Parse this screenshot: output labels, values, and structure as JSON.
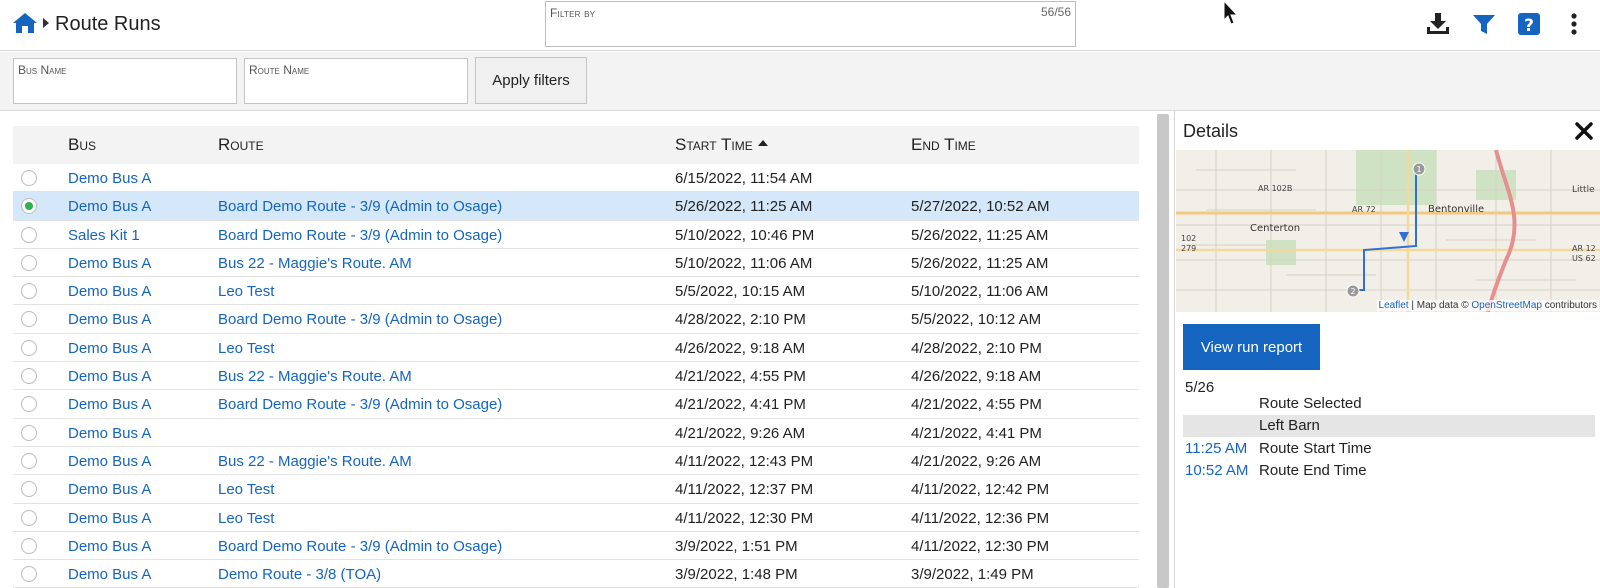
{
  "header": {
    "page_title": "Route Runs",
    "filter_label": "Filter by",
    "filter_count": "56/56"
  },
  "filters": {
    "bus_name_label": "Bus Name",
    "route_name_label": "Route Name",
    "apply_label": "Apply filters"
  },
  "table": {
    "columns": {
      "bus": "Bus",
      "route": "Route",
      "start": "Start Time",
      "end": "End Time"
    },
    "rows": [
      {
        "bus": "Demo Bus A",
        "route": "",
        "start": "6/15/2022, 11:54 AM",
        "end": "",
        "selected": false
      },
      {
        "bus": "Demo Bus A",
        "route": "Board Demo Route - 3/9 (Admin to Osage)",
        "start": "5/26/2022, 11:25 AM",
        "end": "5/27/2022, 10:52 AM",
        "selected": true
      },
      {
        "bus": "Sales Kit 1",
        "route": "Board Demo Route - 3/9 (Admin to Osage)",
        "start": "5/10/2022, 10:46 PM",
        "end": "5/26/2022, 11:25 AM",
        "selected": false
      },
      {
        "bus": "Demo Bus A",
        "route": "Bus 22 - Maggie's Route. AM",
        "start": "5/10/2022, 11:06 AM",
        "end": "5/26/2022, 11:25 AM",
        "selected": false
      },
      {
        "bus": "Demo Bus A",
        "route": "Leo Test",
        "start": "5/5/2022, 10:15 AM",
        "end": "5/10/2022, 11:06 AM",
        "selected": false
      },
      {
        "bus": "Demo Bus A",
        "route": "Board Demo Route - 3/9 (Admin to Osage)",
        "start": "4/28/2022, 2:10 PM",
        "end": "5/5/2022, 10:12 AM",
        "selected": false
      },
      {
        "bus": "Demo Bus A",
        "route": "Leo Test",
        "start": "4/26/2022, 9:18 AM",
        "end": "4/28/2022, 2:10 PM",
        "selected": false
      },
      {
        "bus": "Demo Bus A",
        "route": "Bus 22 - Maggie's Route. AM",
        "start": "4/21/2022, 4:55 PM",
        "end": "4/26/2022, 9:18 AM",
        "selected": false
      },
      {
        "bus": "Demo Bus A",
        "route": "Board Demo Route - 3/9 (Admin to Osage)",
        "start": "4/21/2022, 4:41 PM",
        "end": "4/21/2022, 4:55 PM",
        "selected": false
      },
      {
        "bus": "Demo Bus A",
        "route": "",
        "start": "4/21/2022, 9:26 AM",
        "end": "4/21/2022, 4:41 PM",
        "selected": false
      },
      {
        "bus": "Demo Bus A",
        "route": "Bus 22 - Maggie's Route. AM",
        "start": "4/11/2022, 12:43 PM",
        "end": "4/21/2022, 9:26 AM",
        "selected": false
      },
      {
        "bus": "Demo Bus A",
        "route": "Leo Test",
        "start": "4/11/2022, 12:37 PM",
        "end": "4/11/2022, 12:42 PM",
        "selected": false
      },
      {
        "bus": "Demo Bus A",
        "route": "Leo Test",
        "start": "4/11/2022, 12:30 PM",
        "end": "4/11/2022, 12:36 PM",
        "selected": false
      },
      {
        "bus": "Demo Bus A",
        "route": "Board Demo Route - 3/9 (Admin to Osage)",
        "start": "3/9/2022, 1:51 PM",
        "end": "4/11/2022, 12:30 PM",
        "selected": false
      },
      {
        "bus": "Demo Bus A",
        "route": "Demo Route - 3/8 (TOA)",
        "start": "3/9/2022, 1:48 PM",
        "end": "3/9/2022, 1:49 PM",
        "selected": false
      }
    ]
  },
  "details": {
    "title": "Details",
    "map_labels": [
      "Bentonville",
      "Centerton",
      "AR 102B",
      "AR 72",
      "102",
      "279",
      "AR 12",
      "US 62",
      "Little"
    ],
    "map_markers": [
      "1",
      "2"
    ],
    "attribution": {
      "leaflet": "Leaflet",
      "sep": " | Map data © ",
      "osm": "OpenStreetMap",
      "tail": " contributors"
    },
    "view_report_label": "View run report",
    "date": "5/26",
    "events": [
      {
        "time": "",
        "desc": "Route Selected",
        "highlight": false
      },
      {
        "time": "",
        "desc": "Left Barn",
        "highlight": true
      },
      {
        "time": "11:25 AM",
        "desc": "Route Start Time",
        "highlight": false
      },
      {
        "time": "10:52 AM",
        "desc": "Route End Time",
        "highlight": false
      }
    ]
  },
  "colors": {
    "accent": "#1565c0",
    "selected_row": "#d5e8f9",
    "radio_on": "#2bb24c"
  },
  "icons": [
    "home-icon",
    "download-icon",
    "filter-icon",
    "help-icon",
    "more-vert-icon",
    "close-icon",
    "cursor-icon"
  ]
}
